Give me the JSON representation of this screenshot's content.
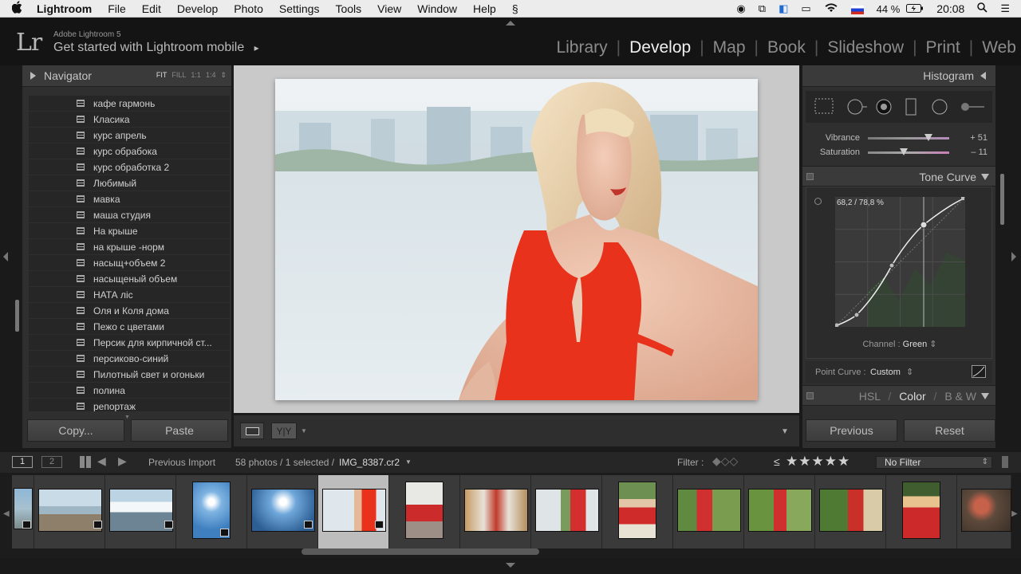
{
  "menubar": {
    "apple": "",
    "items": [
      "Lightroom",
      "File",
      "Edit",
      "Develop",
      "Photo",
      "Settings",
      "Tools",
      "View",
      "Window",
      "Help"
    ],
    "battery": "44 %",
    "time": "20:08"
  },
  "identity": {
    "logo": "Lr",
    "small": "Adobe Lightroom 5",
    "big": "Get started with Lightroom mobile",
    "big_arrow": "▸"
  },
  "modules": [
    "Library",
    "Develop",
    "Map",
    "Book",
    "Slideshow",
    "Print",
    "Web"
  ],
  "active_module": "Develop",
  "navigator": {
    "title": "Navigator",
    "options": [
      "FIT",
      "FILL",
      "1:1",
      "1:4"
    ]
  },
  "presets": [
    "кафе гармонь",
    "Класика",
    "курс апрель",
    "курс обрабока",
    "курс обработка 2",
    "Любимый",
    "мавка",
    "маша студия",
    "На крыше",
    "на крыше -норм",
    "насыщ+объем 2",
    "насыщеный объем",
    "НАТА ліс",
    "Оля и Коля дома",
    "Пежо с цветами",
    "Персик для кирпичной ст...",
    "персиково-синий",
    "Пилотный свет и огоньки",
    "полина",
    "репортаж"
  ],
  "left_buttons": {
    "copy": "Copy...",
    "paste": "Paste"
  },
  "right_panel": {
    "histogram": "Histogram",
    "vibrance": {
      "label": "Vibrance",
      "value": "+ 51",
      "pos": 0.745
    },
    "saturation": {
      "label": "Saturation",
      "value": "– 11",
      "pos": 0.445
    },
    "tone_curve": "Tone Curve",
    "curve_readout": "68,2 / 78,8 %",
    "channel_label": "Channel :",
    "channel_value": "Green",
    "point_curve_label": "Point Curve :",
    "point_curve_value": "Custom",
    "hsl_tabs": [
      "HSL",
      "Color",
      "B & W"
    ],
    "previous": "Previous",
    "reset": "Reset"
  },
  "filmbar": {
    "page1": "1",
    "page2": "2",
    "source": "Previous Import",
    "count": "58 photos / 1 selected /",
    "filename": "IMG_8387.cr2",
    "filter_label": "Filter :",
    "rating_op": "≤",
    "stars": "★★★★★",
    "filter_select": "No Filter"
  },
  "colors": {
    "accent": "#f0f0f0",
    "panel": "#2f2f2f",
    "dress": "#e8321c"
  }
}
